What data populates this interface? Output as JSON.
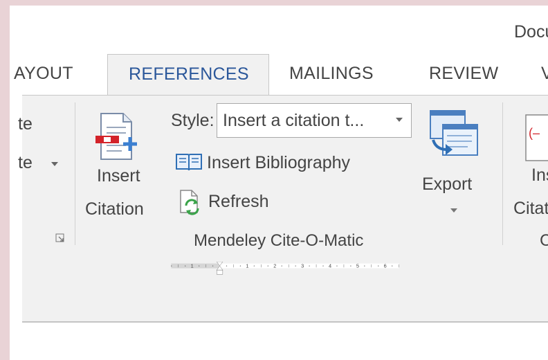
{
  "window": {
    "title_fragment": "Docu"
  },
  "tabs": [
    {
      "label": "AYOUT",
      "active": false
    },
    {
      "label": "REFERENCES",
      "active": true
    },
    {
      "label": "MAILINGS",
      "active": false
    },
    {
      "label": "REVIEW",
      "active": false
    },
    {
      "label": "V",
      "active": false
    }
  ],
  "ribbon": {
    "left_partial": {
      "line1": "te",
      "line2": "te"
    },
    "insert_citation": {
      "line1": "Insert",
      "line2": "Citation",
      "icon": "insert-citation-icon"
    },
    "style": {
      "label": "Style:",
      "value": "Insert a citation t...",
      "arrow": "▾"
    },
    "insert_bibliography": {
      "label": "Insert Bibliography",
      "icon": "book-icon"
    },
    "refresh": {
      "label": "Refresh",
      "icon": "refresh-icon"
    },
    "export": {
      "label": "Export",
      "icon": "export-icon"
    },
    "right_partial": {
      "line1": "Ins",
      "line2": "Citati",
      "group_fragment": "C"
    },
    "group_label": "Mendeley Cite-O-Matic"
  },
  "ruler": {
    "numbers": [
      "1",
      "1",
      "2",
      "3",
      "4",
      "5",
      "6"
    ]
  },
  "colors": {
    "accent": "#2b579a",
    "ribbon_bg": "#f1f1f1",
    "text": "#444444"
  }
}
